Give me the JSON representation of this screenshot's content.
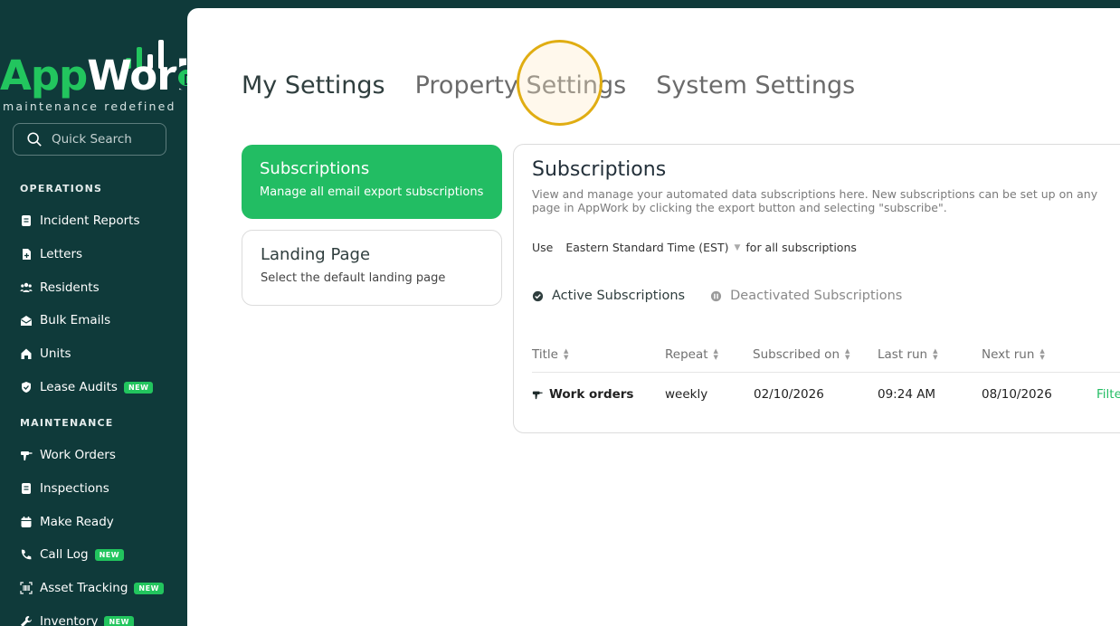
{
  "brand": {
    "name_part1": "App",
    "name_part2": "Work",
    "tagline": "maintenance redefined"
  },
  "search": {
    "label": "Quick Search"
  },
  "sidebar": {
    "sections": [
      {
        "title": "OPERATIONS",
        "items": [
          {
            "label": "Incident Reports",
            "icon": "document-icon"
          },
          {
            "label": "Letters",
            "icon": "letter-file-icon"
          },
          {
            "label": "Residents",
            "icon": "people-icon"
          },
          {
            "label": "Bulk Emails",
            "icon": "envelope-icon"
          },
          {
            "label": "Units",
            "icon": "home-icon"
          },
          {
            "label": "Lease Audits",
            "icon": "shield-check-icon",
            "badge": "NEW"
          }
        ]
      },
      {
        "title": "MAINTENANCE",
        "items": [
          {
            "label": "Work Orders",
            "icon": "drill-icon"
          },
          {
            "label": "Inspections",
            "icon": "clipboard-icon"
          },
          {
            "label": "Make Ready",
            "icon": "calendar-icon"
          },
          {
            "label": "Call Log",
            "icon": "phone-icon",
            "badge": "NEW"
          },
          {
            "label": "Asset Tracking",
            "icon": "barcode-icon",
            "badge": "NEW"
          },
          {
            "label": "Inventory",
            "icon": "wrench-icon",
            "badge": "NEW"
          }
        ]
      }
    ]
  },
  "settings_tabs": [
    {
      "label": "My Settings",
      "active": true
    },
    {
      "label": "Property Settings",
      "active": false
    },
    {
      "label": "System Settings",
      "active": false
    }
  ],
  "cards": [
    {
      "title": "Subscriptions",
      "desc": "Manage all email export subscriptions",
      "selected": true
    },
    {
      "title": "Landing Page",
      "desc": "Select the default landing page",
      "selected": false
    }
  ],
  "panel": {
    "title": "Subscriptions",
    "desc": "View and manage your automated data subscriptions here. New subscriptions can be set up on any page in AppWork by clicking the export button and selecting \"subscribe\".",
    "tz_prefix": "Use",
    "tz_value": "Eastern Standard Time (EST)",
    "tz_suffix": "for all subscriptions",
    "sub_tabs": {
      "active": "Active Subscriptions",
      "inactive": "Deactivated Subscriptions"
    },
    "columns": [
      "Title",
      "Repeat",
      "Subscribed on",
      "Last run",
      "Next run"
    ],
    "rows": [
      {
        "title": "Work orders",
        "repeat": "weekly",
        "subscribed_on": "02/10/2026",
        "last_run": "09:24 AM",
        "next_run": "08/10/2026",
        "action": "Filte"
      }
    ]
  },
  "colors": {
    "sidebar_bg": "#0f3a3a",
    "accent_green": "#22bd63",
    "highlight_ring": "#e0ad12"
  }
}
